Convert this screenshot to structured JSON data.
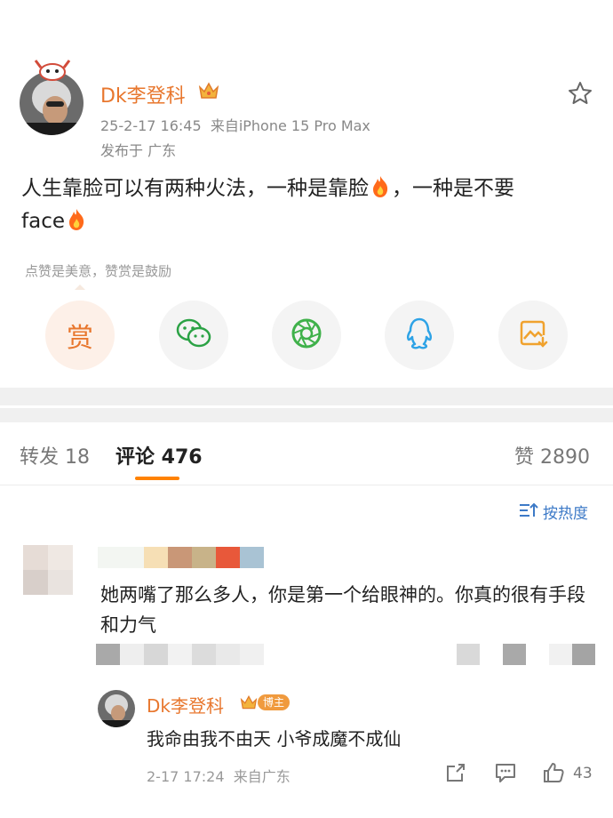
{
  "post": {
    "author": "Dk李登科",
    "timestamp": "25-2-17 16:45",
    "source": "来自iPhone 15 Pro Max",
    "location": "发布于 广东",
    "text_part1": "人生靠脸可以有两种火法，一种是靠脸",
    "text_part2": "，一种是不要",
    "text_part3": "face",
    "fire_emoji": "🔥"
  },
  "reward": {
    "hint": "点赞是美意，赞赏是鼓励",
    "button_label": "赏"
  },
  "share_icons": [
    "reward-icon",
    "wechat-icon",
    "moments-icon",
    "qq-icon",
    "save-image-icon"
  ],
  "tabs": {
    "forward_label": "转发 18",
    "comment_label": "评论 476",
    "like_label": "赞 2890"
  },
  "sort": {
    "label": "按热度"
  },
  "comments": [
    {
      "text": "她两嘴了那么多人，你是第一个给眼神的。你真的很有手段和力气",
      "reply": {
        "author": "Dk李登科",
        "badge": "博主",
        "text": "我命由我不由天 小爷成魔不成仙",
        "timestamp": "2-17 17:24",
        "source": "来自广东",
        "like_count": "43"
      }
    }
  ],
  "colors": {
    "accent_orange": "#ff8200",
    "name_orange": "#e8772e",
    "link_blue": "#3d7ac7"
  }
}
